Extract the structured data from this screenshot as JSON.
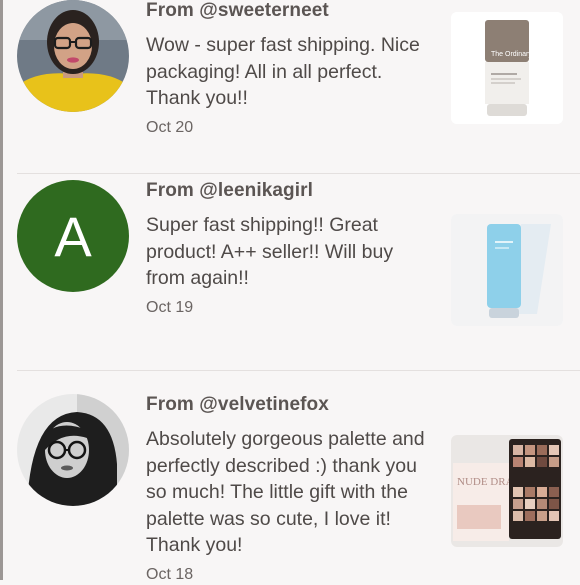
{
  "reviews": [
    {
      "from": "From @sweeterneet",
      "message": "Wow - super fast shipping. Nice packaging! All in all perfect. Thank you!!",
      "date": "Oct 20",
      "avatar": "photo",
      "product_brand": "The Ordinary."
    },
    {
      "from": "From @leenikagirl",
      "message": "Super fast shipping!! Great product! A++ seller!! Will buy from again!!",
      "date": "Oct 19",
      "avatar": "letter",
      "avatar_letter": "A",
      "avatar_color": "#2f6a1f"
    },
    {
      "from": "From @velvetinefox",
      "message": "Absolutely gorgeous palette and perfectly described :) thank you so much! The little gift with the palette was so cute, I love it! Thank you!",
      "date": "Oct 18",
      "avatar": "photo-grayscale",
      "product_box_text": "NUDE DRAMA"
    }
  ],
  "colors": {
    "background": "#f8f6f6",
    "text": "#4f4a48",
    "divider": "#e4e0df"
  }
}
